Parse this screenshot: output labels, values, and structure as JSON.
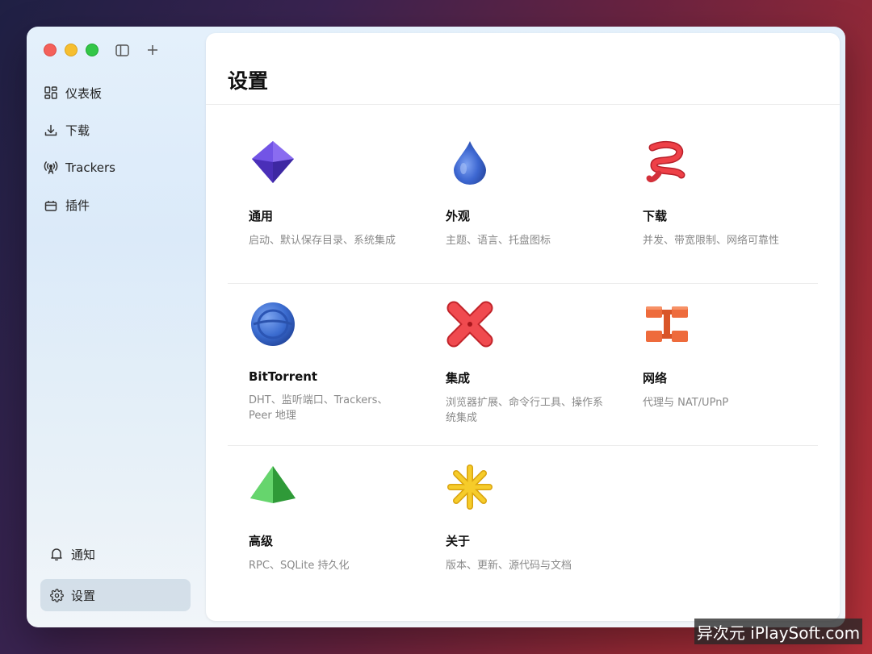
{
  "sidebar": {
    "items": [
      {
        "label": "仪表板",
        "icon": "dashboard-icon"
      },
      {
        "label": "下载",
        "icon": "download-icon"
      },
      {
        "label": "Trackers",
        "icon": "antenna-icon"
      },
      {
        "label": "插件",
        "icon": "plugin-icon"
      }
    ],
    "bottom": [
      {
        "label": "通知",
        "icon": "bell-icon"
      },
      {
        "label": "设置",
        "icon": "gear-icon",
        "active": true
      }
    ]
  },
  "page": {
    "title": "设置"
  },
  "cards": [
    {
      "title": "通用",
      "desc": "启动、默认保存目录、系统集成",
      "icon": "octahedron-icon",
      "color": "#6a4ad8"
    },
    {
      "title": "外观",
      "desc": "主题、语言、托盘图标",
      "icon": "droplet-icon",
      "color": "#3d67d1"
    },
    {
      "title": "下载",
      "desc": "并发、带宽限制、网络可靠性",
      "icon": "coil-icon",
      "color": "#e0353a"
    },
    {
      "title": "BitTorrent",
      "desc": "DHT、监听端口、Trackers、Peer 地理",
      "icon": "globe-icon",
      "color": "#3b6cd0"
    },
    {
      "title": "集成",
      "desc": "浏览器扩展、命令行工具、操作系统集成",
      "icon": "cross-icon",
      "color": "#e2393e"
    },
    {
      "title": "网络",
      "desc": "代理与 NAT/UPnP",
      "icon": "network-blocks-icon",
      "color": "#ee6b3c"
    },
    {
      "title": "高级",
      "desc": "RPC、SQLite 持久化",
      "icon": "pyramid-icon",
      "color": "#43b84c"
    },
    {
      "title": "关于",
      "desc": "版本、更新、源代码与文档",
      "icon": "asterisk-icon",
      "color": "#f2c21d"
    }
  ],
  "watermark": "异次元 iPlaySoft.com"
}
